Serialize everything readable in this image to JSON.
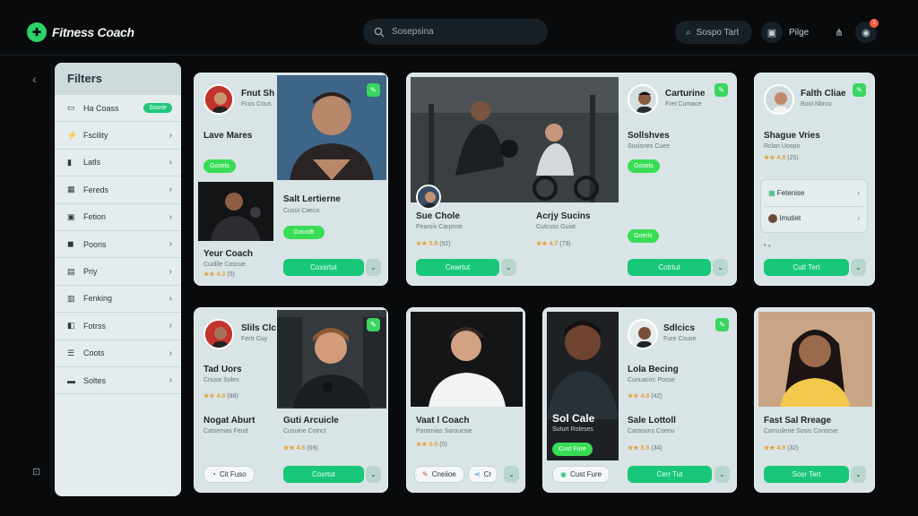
{
  "app": {
    "title": "Fitness Coach"
  },
  "search": {
    "placeholder": "Sosepsina"
  },
  "header": {
    "pill1": "Sospo Tart",
    "pill2": "Pilge",
    "notif_count": "1"
  },
  "filters": {
    "title": "Filters",
    "items": [
      {
        "label": "Ha Coass",
        "tag": "Sosrie",
        "icon": "monitor-icon"
      },
      {
        "label": "Fscility",
        "icon": "bolt-icon"
      },
      {
        "label": "Latls",
        "icon": "chart-icon"
      },
      {
        "label": "Fereds",
        "icon": "grid-icon"
      },
      {
        "label": "Fetion",
        "icon": "frame-icon"
      },
      {
        "label": "Pooris",
        "icon": "board-icon"
      },
      {
        "label": "Priy",
        "icon": "doc-icon"
      },
      {
        "label": "Fenking",
        "icon": "bars-icon"
      },
      {
        "label": "Fotrss",
        "icon": "box-icon"
      },
      {
        "label": "Coots",
        "icon": "list-icon"
      },
      {
        "label": "Soltes",
        "icon": "folder-icon"
      }
    ]
  },
  "cards": {
    "c1": {
      "name": "Fnut Sh",
      "sub": "Fcus Cous",
      "h2": "Lave Mares",
      "chip": "Goseis",
      "name2": "Salt Lertierne",
      "sub2": "Cusut Caeco",
      "chip2": "Govotlt",
      "h3": "Yeur Coach",
      "sub3": "Cuidlle Coscue",
      "rate": "★★ 4.3",
      "rate_count": "(5)",
      "btn": "Coxsrtut"
    },
    "c2": {
      "name": "Sue Chole",
      "sub": "Pearsiv Carpnne",
      "rate": "★★ 5.8",
      "rate_count": "(92)",
      "name2": "Acrjy Sucins",
      "sub2": "Cutcuss Guiat",
      "rate2": "★★ 4.7",
      "rate2_count": "(79)",
      "btn": "Cewrtut"
    },
    "c3": {
      "name": "Carturine",
      "sub": "Fret Cumace",
      "h2": "Sollshves",
      "sub2": "Susisnes Cuee",
      "chip": "Goseis",
      "chip2": "Goeris",
      "btn": "Cotrtut"
    },
    "c4": {
      "name": "Falth Cliae",
      "sub": "Bool Nbrco",
      "h2": "Shague Vries",
      "sub2": "Rclan Uoopo",
      "rate": "★★ 4.8",
      "rate_count": "(25)",
      "p1": "Fetenise",
      "p2": "Imutiet",
      "dots": "• ⁎",
      "btn": "Cutt Tert"
    },
    "c5": {
      "name": "Slils Clc",
      "sub": "Fertr Cuy",
      "h2": "Tad Uors",
      "sub2": "Cnuse Soles",
      "rate": "★★ 4.8",
      "rate_count": "(88)",
      "h3": "Nogat Aburt",
      "sub3": "Catsemas Feud",
      "chip": "Cit Fuso",
      "name2": "Guti Arcuicle",
      "sub2b": "Cusuine Coinct",
      "rate2": "★★ 4.8",
      "rate2_count": "(69)",
      "btn": "Coxrtut"
    },
    "c6": {
      "name": "Vaat l Coach",
      "sub": "Paramias Saroucsie",
      "rate": "★★ 5.0",
      "rate_count": "(5)",
      "chip": "Cneiioe",
      "chip2": "Cr"
    },
    "c7": {
      "name": "Sdlcics",
      "sub": "Fure Couxe",
      "h2": "Lola Becing",
      "sub2": "Cunuacirc Posse",
      "rate": "★★ 4.8",
      "rate_count": "(42)",
      "overlay": "Sol Cale",
      "overlay_sub": "Suturt Roleses",
      "overlay_chip": "Cust Fure",
      "h3": "Sale Lottoll",
      "sub3": "Carasuns Coenu",
      "rate3": "★★ 5.5",
      "rate3_count": "(34)",
      "btn": "Cerr Tut"
    },
    "c8": {
      "name": "Fast Sal Rreage",
      "sub": "Carruslene Sosis Consrsie",
      "rate": "★★ 4.9",
      "rate_count": "(32)",
      "btn": "Sosr Tert"
    }
  },
  "colors": {
    "accent": "#18c779",
    "chip": "#39dc55",
    "card": "#d9e4e6",
    "bg": "#080a0c"
  }
}
